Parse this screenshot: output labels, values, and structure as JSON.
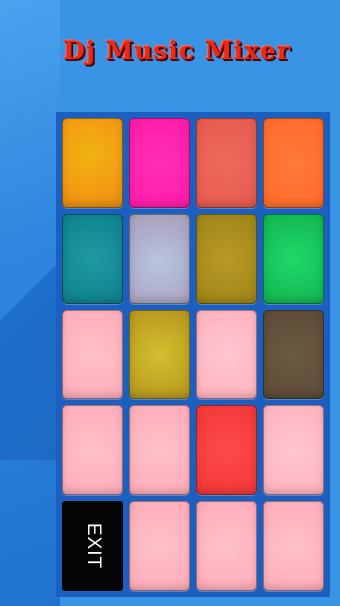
{
  "app": {
    "title": "Dj Music Mixer"
  },
  "pads": [
    {
      "id": "r1c1",
      "color": "radial-gradient(circle at 45% 40%, #f0b212 0%, #f39c12 60%, #e88a10 100%)"
    },
    {
      "id": "r1c2",
      "color": "radial-gradient(circle at 50% 50%, #ff2fb4 0%, #ff1aa8 100%)"
    },
    {
      "id": "r1c3",
      "color": "radial-gradient(circle at 50% 50%, #ec6a5c 0%, #e75a4d 100%)"
    },
    {
      "id": "r1c4",
      "color": "radial-gradient(circle at 50% 50%, #ff7a3a 0%, #ff6a2a 100%)"
    },
    {
      "id": "r2c1",
      "color": "radial-gradient(circle at 50% 50%, #1f9aa5 0%, #0d7f8c 100%)"
    },
    {
      "id": "r2c2",
      "color": "radial-gradient(circle at 50% 55%, #b8c6e0 0%, #a79bb8 100%)"
    },
    {
      "id": "r2c3",
      "color": "radial-gradient(circle at 50% 50%, #b99a25 0%, #9c8418 100%)"
    },
    {
      "id": "r2c4",
      "color": "radial-gradient(circle at 50% 50%, #1fd86a 0%, #12b34f 100%)"
    },
    {
      "id": "r3c1",
      "color": "radial-gradient(circle at 50% 50%, #ffc1c9 0%, #ffabb8 100%)"
    },
    {
      "id": "r3c2",
      "color": "radial-gradient(circle at 50% 50%, #d2c030 0%, #b5931c 100%)"
    },
    {
      "id": "r3c3",
      "color": "radial-gradient(circle at 50% 50%, #ffc7cf 0%, #ffb1bd 100%)"
    },
    {
      "id": "r3c4",
      "color": "radial-gradient(circle at 50% 50%, #6d5a44 0%, #5c4a37 100%)"
    },
    {
      "id": "r4c1",
      "color": "radial-gradient(circle at 50% 50%, #ffc1c9 0%, #ffabb8 100%)"
    },
    {
      "id": "r4c2",
      "color": "radial-gradient(circle at 50% 50%, #ffc1c9 0%, #ffabb8 100%)"
    },
    {
      "id": "r4c3",
      "color": "radial-gradient(circle at 50% 50%, #ff4a4a 0%, #f23636 100%)"
    },
    {
      "id": "r4c4",
      "color": "radial-gradient(circle at 50% 50%, #ffc7cf 0%, #ffb1bd 100%)"
    },
    {
      "id": "r5c2",
      "color": "radial-gradient(circle at 50% 50%, #ffc1c9 0%, #ffabb8 100%)"
    },
    {
      "id": "r5c3",
      "color": "radial-gradient(circle at 50% 50%, #ffc1c9 0%, #ffabb8 100%)"
    },
    {
      "id": "r5c4",
      "color": "radial-gradient(circle at 50% 50%, #ffc1c9 0%, #ffabb8 100%)"
    }
  ],
  "exit_button": {
    "label": "EXIT"
  }
}
